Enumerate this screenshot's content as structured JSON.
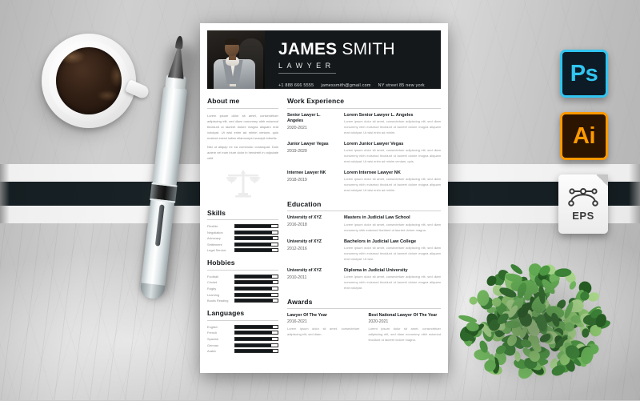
{
  "scene": {
    "background": "marble-gray",
    "band_color": "#1b2529",
    "objects": [
      "coffee-cup",
      "pen",
      "plant"
    ]
  },
  "badges": [
    {
      "name": "photoshop-badge",
      "label": "Ps",
      "color": "#31c5f0",
      "bg": "#0d1b26"
    },
    {
      "name": "illustrator-badge",
      "label": "Ai",
      "color": "#ff9a00",
      "bg": "#2b1400"
    },
    {
      "name": "eps-badge",
      "label": "EPS",
      "color": "#3a3a3a",
      "bg": "#fdfdfd"
    }
  ],
  "resume": {
    "header": {
      "first_name": "JAMES",
      "last_name": "SMITH",
      "role": "LAWYER",
      "phone": "+1 888 666 5555",
      "email": "jamessmith@gmail.com",
      "address": "NY street 85 new york"
    },
    "about": {
      "title": "About me",
      "p1": "Lorem ipsum dolor sit amet, consectetuer adipiscing elit, sed diam nonummy nibh euismod tincidunt ut laoreet dolore magna aliquam erat volutpat. Ut wisi enim ad minim veniam, quis nostrud exerci tation ullamcorper suscipit lobortis.",
      "p2": "Nisi ut aliquip ex ea commodo consequat. Duis autem vel eum iriure dolor in hendrerit in vulputate velit."
    },
    "skills": {
      "title": "Skills",
      "items": [
        {
          "label": "Flexible",
          "value": 84
        },
        {
          "label": "Negotiation",
          "value": 86
        },
        {
          "label": "Advocacy",
          "value": 88
        },
        {
          "label": "Settlement",
          "value": 85
        },
        {
          "label": "Legal Service",
          "value": 87
        }
      ]
    },
    "hobbies": {
      "title": "Hobbies",
      "items": [
        {
          "label": "Football",
          "value": 86
        },
        {
          "label": "Cricket",
          "value": 88
        },
        {
          "label": "Rugby",
          "value": 87
        },
        {
          "label": "Learning",
          "value": 85
        },
        {
          "label": "Books Reading",
          "value": 89
        }
      ]
    },
    "languages": {
      "title": "Languages",
      "items": [
        {
          "label": "English",
          "value": 88
        },
        {
          "label": "French",
          "value": 86
        },
        {
          "label": "Spanish",
          "value": 87
        },
        {
          "label": "German",
          "value": 85
        },
        {
          "label": "Arabic",
          "value": 88
        }
      ]
    },
    "work": {
      "title": "Work Experience",
      "entries": [
        {
          "position": "Senior Lawyer L. Angeles",
          "date": "2020-2021",
          "heading": "Lorem Senior Lawyer L. Angeles",
          "desc": "Lorem ipsum dolor sit amet, consectetuer adipiscing elit, sed diam nonummy nibh euismod tincidunt ut laoreet dolore magna aliquam erat volutpat. Ut wisi enim ad minim."
        },
        {
          "position": "Junior Lawyer Vegas",
          "date": "2019-2020",
          "heading": "Lorem Junior Lawyer Vegas",
          "desc": "Lorem ipsum dolor sit amet, consectetuer adipiscing elit, sed diam nonummy nibh euismod tincidunt ut laoreet dolore magna aliquam erat volutpat. Ut wisi enim ad minim veniam, quis."
        },
        {
          "position": "Internee Lawyer NK",
          "date": "2018-2019",
          "heading": "Lorem Internee Lawyer NK",
          "desc": "Lorem ipsum dolor sit amet, consectetuer adipiscing elit, sed diam nonummy nibh euismod tincidunt ut laoreet dolore magna aliquam erat volutpat. Ut wisi enim ad minim."
        }
      ]
    },
    "education": {
      "title": "Education",
      "entries": [
        {
          "position": "University of XYZ",
          "date": "2016-2018",
          "heading": "Masters in Judicial Law School",
          "desc": "Lorem ipsum dolor sit amet, consectetuer adipiscing elit, sed diam nonummy nibh euismod tincidunt ut laoreet dolore magna."
        },
        {
          "position": "University of XYZ",
          "date": "2012-2016",
          "heading": "Bachelors in Judicial Law College",
          "desc": "Lorem ipsum dolor sit amet, consectetuer adipiscing elit, sed diam nonummy nibh euismod tincidunt ut laoreet dolore magna aliquam erat volutpat. Ut wisi."
        },
        {
          "position": "University of XYZ",
          "date": "2010-2011",
          "heading": "Diploma in Judicial University",
          "desc": "Lorem ipsum dolor sit amet, consectetuer adipiscing elit, sed diam nonummy nibh euismod tincidunt ut laoreet dolore magna aliquam erat volutpat."
        }
      ]
    },
    "awards": {
      "title": "Awards",
      "items": [
        {
          "title": "Lawyer Of The Year",
          "date": "2016-2021",
          "desc": "Lorem ipsum dolor sit amet, consectetuer adipiscing elit, sed diam."
        },
        {
          "title": "Best National Lawyer Of The Year",
          "date": "2020-2021",
          "desc": "Lorem ipsum dolor sit amet, consectetuer adipiscing elit, sed diam nonummy nibh euismod tincidunt ut laoreet dolore magna."
        }
      ]
    }
  }
}
